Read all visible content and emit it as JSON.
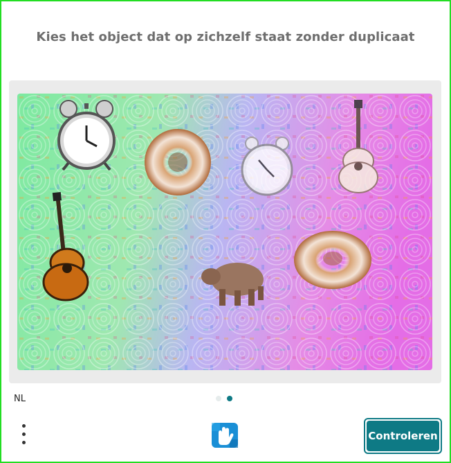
{
  "prompt": "Kies het object dat op zichzelf staat zonder duplicaat",
  "language": "NL",
  "submit_label": "Controleren",
  "pagination": {
    "total": 2,
    "active": 2
  },
  "colors": {
    "accent": "#0e7a85",
    "frame": "#22dd22",
    "dot_inactive": "#e6ecec"
  },
  "objects": [
    {
      "name": "alarm-clock",
      "icon": "alarm-clock-icon"
    },
    {
      "name": "donut",
      "icon": "donut-icon"
    },
    {
      "name": "clock",
      "icon": "clock-icon"
    },
    {
      "name": "guitar",
      "icon": "guitar-icon"
    },
    {
      "name": "guitar",
      "icon": "guitar-icon"
    },
    {
      "name": "hippo",
      "icon": "hippo-icon"
    },
    {
      "name": "bagel",
      "icon": "donut-icon"
    }
  ]
}
